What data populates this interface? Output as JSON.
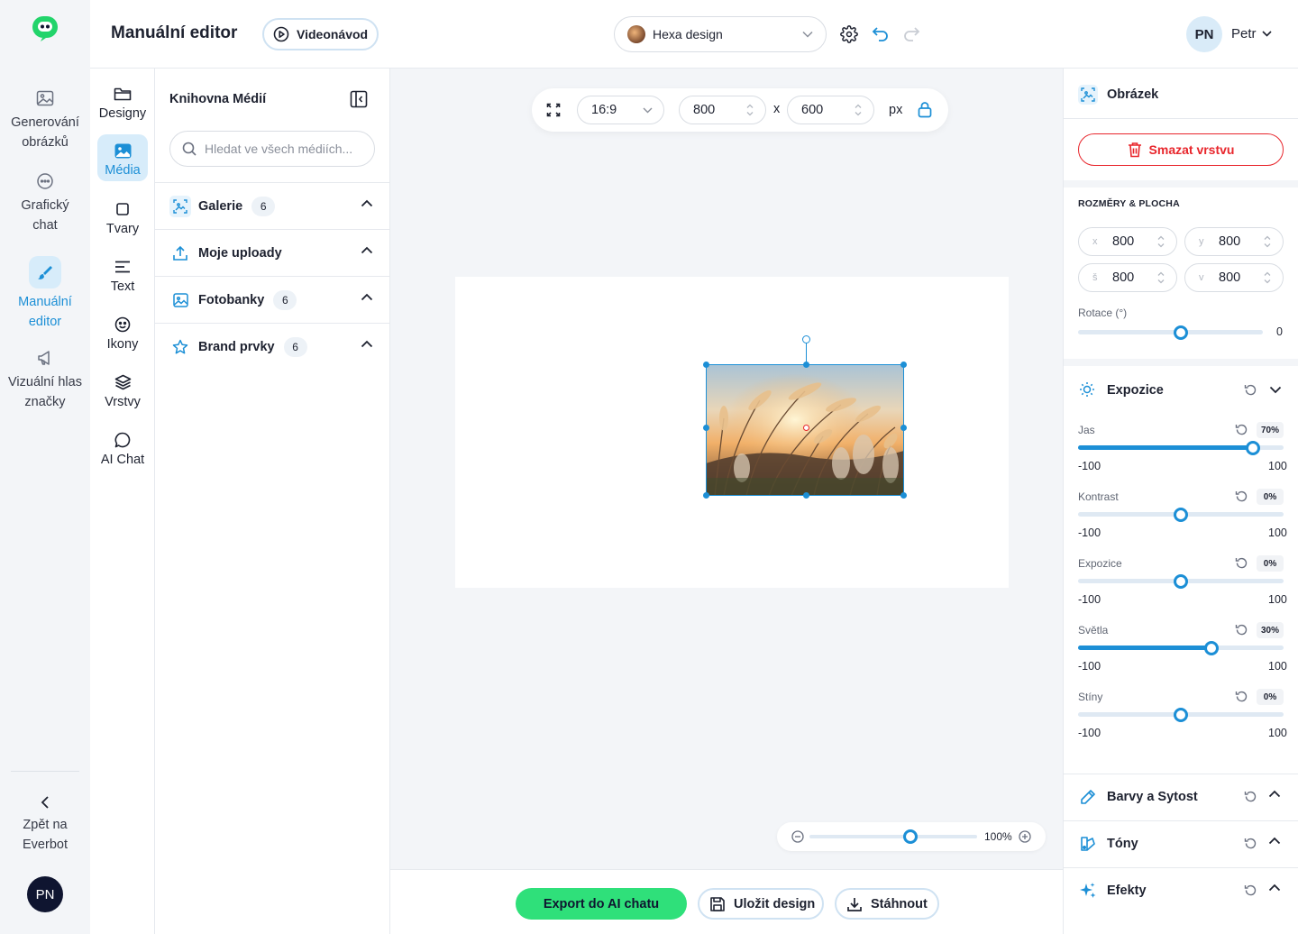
{
  "rail": {
    "items": [
      {
        "label_1": "Generování",
        "label_2": "obrázků"
      },
      {
        "label_1": "Grafický",
        "label_2": "chat"
      },
      {
        "label_1": "Manuální",
        "label_2": "editor"
      },
      {
        "label_1": "Vizuální hlas",
        "label_2": "značky"
      }
    ],
    "back_1": "Zpět na",
    "back_2": "Everbot",
    "avatar": "PN"
  },
  "header": {
    "title": "Manuální editor",
    "video_label": "Videonávod",
    "design_name": "Hexa design",
    "user_initials": "PN",
    "user_name": "Petr"
  },
  "tools": [
    "Designy",
    "Média",
    "Tvary",
    "Text",
    "Ikony",
    "Vrstvy",
    "AI Chat"
  ],
  "media": {
    "title": "Knihovna Médií",
    "search_placeholder": "Hledat ve všech médiích...",
    "sections": [
      {
        "label": "Galerie",
        "count": "6"
      },
      {
        "label": "Moje uploady",
        "count": ""
      },
      {
        "label": "Fotobanky",
        "count": "6"
      },
      {
        "label": "Brand prvky",
        "count": "6"
      }
    ]
  },
  "canvas": {
    "ratio": "16:9",
    "width": "800",
    "times": "x",
    "height": "600",
    "unit": "px",
    "zoom_label": "100%",
    "zoom_level": 0.6
  },
  "actions": {
    "export": "Export do AI chatu",
    "save": "Uložit design",
    "download": "Stáhnout"
  },
  "props": {
    "title": "Obrázek",
    "delete": "Smazat vrstvu",
    "dims_header": "ROZMĚRY & PLOCHA",
    "x_label": "x",
    "x": "800",
    "y_label": "y",
    "y": "800",
    "w_label": "š",
    "w": "800",
    "h_label": "v",
    "h": "800",
    "rotation_label": "Rotace (°)",
    "rotation_value": "0",
    "exposure_title": "Expozice",
    "sliders": [
      {
        "label": "Jas",
        "pct": "70%",
        "value": 70,
        "min": "-100",
        "max": "100"
      },
      {
        "label": "Kontrast",
        "pct": "0%",
        "value": 0,
        "min": "-100",
        "max": "100"
      },
      {
        "label": "Expozice",
        "pct": "0%",
        "value": 0,
        "min": "-100",
        "max": "100"
      },
      {
        "label": "Světla",
        "pct": "30%",
        "value": 30,
        "min": "-100",
        "max": "100"
      },
      {
        "label": "Stíny",
        "pct": "0%",
        "value": 0,
        "min": "-100",
        "max": "100"
      }
    ],
    "sections": [
      "Barvy a Sytost",
      "Tóny",
      "Efekty"
    ]
  },
  "colors": {
    "accent": "#1c8fd6",
    "export_green": "#2fe07a",
    "danger": "#e8262c",
    "logo_green": "#22d46b"
  }
}
